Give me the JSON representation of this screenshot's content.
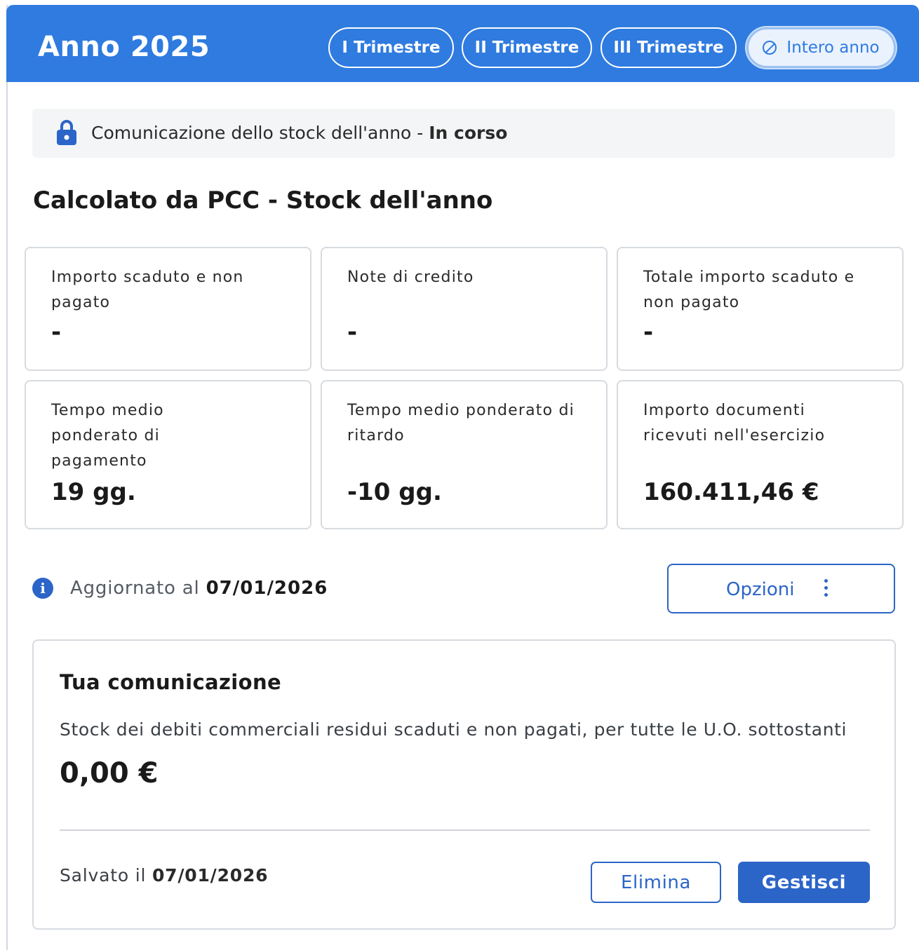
{
  "header": {
    "title": "Anno 2025",
    "tabs": [
      {
        "label": "I Trimestre",
        "active": false
      },
      {
        "label": "II Trimestre",
        "active": false
      },
      {
        "label": "III Trimestre",
        "active": false
      },
      {
        "label": "Intero anno",
        "active": true,
        "icon": "no-entry-icon"
      }
    ]
  },
  "status": {
    "icon": "lock-icon",
    "text": "Comunicazione dello stock dell'anno - ",
    "state": "In corso"
  },
  "section": {
    "title": "Calcolato da PCC - Stock dell'anno"
  },
  "cards": [
    {
      "label": "Importo scaduto e non pagato",
      "value": "-"
    },
    {
      "label": "Note di credito",
      "value": "-"
    },
    {
      "label": "Totale importo scaduto e non pagato",
      "value": "-"
    },
    {
      "label": "Tempo medio ponderato di pagamento",
      "value": "19 gg."
    },
    {
      "label": "Tempo medio ponderato di ritardo",
      "value": "-10 gg."
    },
    {
      "label": "Importo documenti ricevuti nell'esercizio",
      "value": "160.411,46 €"
    }
  ],
  "update": {
    "icon": "info-icon",
    "label": "Aggiornato al",
    "date": "07/01/2026"
  },
  "options_button": {
    "label": "Opzioni",
    "icon": "kebab-menu-icon"
  },
  "communication": {
    "title": "Tua comunicazione",
    "description": "Stock dei debiti commerciali residui scaduti e non pagati, per tutte le U.O. sottostanti",
    "amount": "0,00 €",
    "saved_label": "Salvato il",
    "saved_date": "07/01/2026",
    "delete_label": "Elimina",
    "manage_label": "Gestisci"
  },
  "colors": {
    "header_bg": "#2f7be0",
    "primary": "#2c65c8",
    "status_bg": "#f4f5f7",
    "card_border": "#d7dbe0"
  }
}
